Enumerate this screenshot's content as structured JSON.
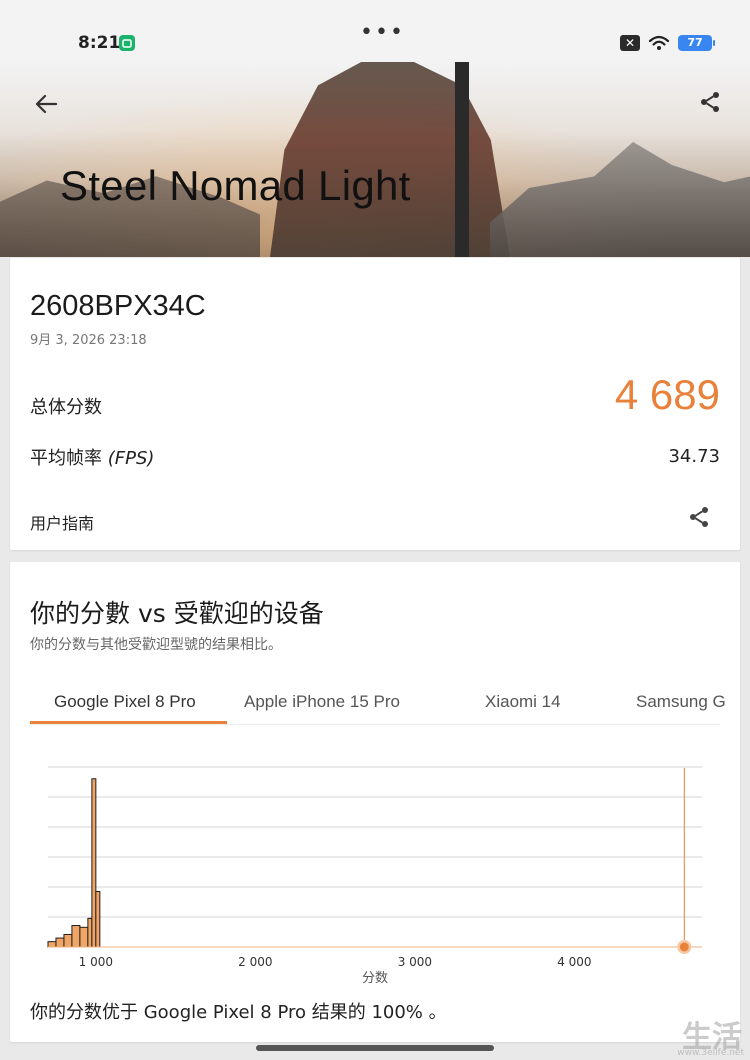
{
  "status_bar": {
    "time": "8:21",
    "dots": "•••",
    "battery": "77"
  },
  "hero": {
    "title": "Steel Nomad Light"
  },
  "result": {
    "device_name": "2608BPX34C",
    "date": "9月 3, 2026 23:18",
    "score_label": "总体分数",
    "score_value": "4 689",
    "fps_label": "平均帧率",
    "fps_unit": "(FPS)",
    "fps_value": "34.73",
    "guide_label": "用户指南"
  },
  "compare": {
    "title": "你的分數 vs 受歡迎的设备",
    "subtitle": "你的分数与其他受歡迎型號的结果相比。",
    "tabs": [
      {
        "label": "Google Pixel 8 Pro"
      },
      {
        "label": "Apple iPhone 15 Pro"
      },
      {
        "label": "Xiaomi 14"
      },
      {
        "label": "Samsung G"
      }
    ],
    "result_text": "你的分数优于 Google Pixel 8 Pro 结果的 100% 。"
  },
  "chart_data": {
    "type": "histogram",
    "xlabel": "分数",
    "ylabel": "",
    "x_ticks": [
      "1 000",
      "2 000",
      "3 000",
      "4 000"
    ],
    "x_tick_values": [
      1000,
      2000,
      3000,
      4000
    ],
    "xlim": [
      700,
      4800
    ],
    "bar_color": "#f0a566",
    "marker_color": "#e8813a",
    "bins": [
      {
        "x0": 700,
        "x1": 750,
        "value": 3
      },
      {
        "x0": 750,
        "x1": 800,
        "value": 5
      },
      {
        "x0": 800,
        "x1": 850,
        "value": 7
      },
      {
        "x0": 850,
        "x1": 900,
        "value": 12
      },
      {
        "x0": 900,
        "x1": 950,
        "value": 11
      },
      {
        "x0": 950,
        "x1": 975,
        "value": 16
      },
      {
        "x0": 975,
        "x1": 1000,
        "value": 94
      },
      {
        "x0": 1000,
        "x1": 1025,
        "value": 31
      }
    ],
    "your_score": 4689
  },
  "watermark": {
    "text": "生活",
    "sub": "www.3elife.net"
  }
}
